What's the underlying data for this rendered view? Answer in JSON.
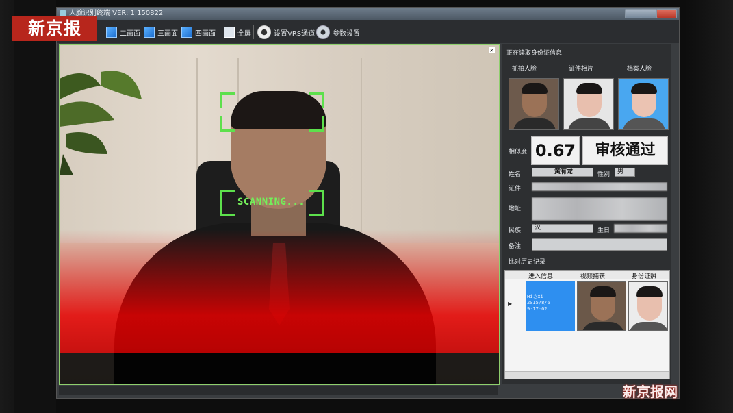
{
  "window": {
    "title": "人脸识别终端 VER: 1.150822"
  },
  "toolbar": {
    "items": [
      {
        "label": "二画面",
        "icon": "two-view-icon"
      },
      {
        "label": "三画面",
        "icon": "three-view-icon"
      },
      {
        "label": "四画面",
        "icon": "four-view-icon"
      },
      {
        "label": "全屏",
        "icon": "fullscreen-icon"
      },
      {
        "label": "设置VRS通道",
        "icon": "camera-icon"
      },
      {
        "label": "参数设置",
        "icon": "gear-icon"
      }
    ]
  },
  "video": {
    "scan_text": "SCANNING..."
  },
  "panel": {
    "status": "正在读取身份证信息",
    "thumb_labels": [
      "抓拍人脸",
      "证件相片",
      "档案人脸"
    ],
    "similarity_label": "相似度",
    "similarity_value": "0.67",
    "result": "审核通过",
    "name_label": "姓名",
    "name_value": "黄有龙",
    "gender_label": "性别",
    "gender_value": "男",
    "id_label": "证件",
    "address_label": "地址",
    "ethnicity_label": "民族",
    "ethnicity_value": "汉",
    "birthday_label": "生日",
    "remark_label": "备注",
    "history_title": "比对历史记录"
  },
  "history": {
    "columns": [
      "进入信息",
      "视频捕获",
      "身份证照"
    ],
    "rows": [
      {
        "line1": "Hiさxi",
        "line2": "2015/8/6",
        "line3": "9:17:02"
      }
    ]
  },
  "watermarks": {
    "top": "新京报",
    "bottom": "新京报网"
  }
}
